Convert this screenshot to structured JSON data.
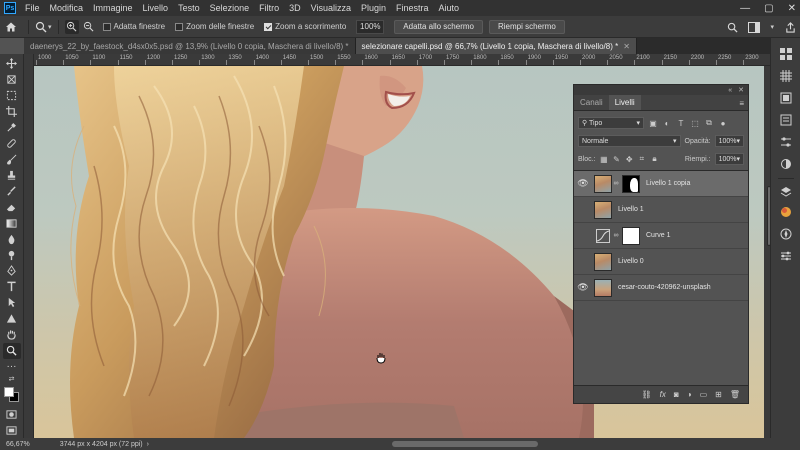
{
  "app": {
    "logo": "Ps",
    "menu": [
      "File",
      "Modifica",
      "Immagine",
      "Livello",
      "Testo",
      "Selezione",
      "Filtro",
      "3D",
      "Visualizza",
      "Plugin",
      "Finestra",
      "Aiuto"
    ],
    "window_controls": [
      "—",
      "▢",
      "✕"
    ]
  },
  "options_bar": {
    "adatta_finestre": "Adatta finestre",
    "adatta_finestre_checked": false,
    "zoom_finestre": "Zoom delle finestre",
    "zoom_finestre_checked": false,
    "zoom_scorrimento": "Zoom a scorrimento",
    "zoom_scorrimento_checked": true,
    "zoom_value": "100%",
    "adatta_schermo": "Adatta allo schermo",
    "riempi_schermo": "Riempi schermo"
  },
  "tabs": [
    {
      "label": "daenerys_22_by_faestock_d4sx0x5.psd @ 13,9% (Livello 0 copia, Maschera di livello/8) *",
      "active": false
    },
    {
      "label": "selezionare capelli.psd @ 66,7% (Livello 1 copia, Maschera di livello/8) *",
      "active": true
    }
  ],
  "ruler": {
    "labels": [
      "1000",
      "1050",
      "1100",
      "1150",
      "1200",
      "1250",
      "1300",
      "1350",
      "1400",
      "1450",
      "1500",
      "1550",
      "1600",
      "1650",
      "1700",
      "1750",
      "1800",
      "1850",
      "1900",
      "1950",
      "2000",
      "2050",
      "2100",
      "2150",
      "2200",
      "2250",
      "2300"
    ]
  },
  "status": {
    "zoom": "66,67%",
    "doc_info": "3744 px x 4204 px (72 ppi)"
  },
  "layers_panel": {
    "tab_channels": "Canali",
    "tab_layers": "Livelli",
    "filter_kind": "Tipo",
    "blend_mode": "Normale",
    "opacity_label": "Opacità:",
    "opacity_value": "100%",
    "lock_label": "Bloc.:",
    "fill_label": "Riempi.:",
    "fill_value": "100%",
    "layers": [
      {
        "name": "Livello 1 copia",
        "visible": true,
        "selected": true,
        "type": "photo-mask"
      },
      {
        "name": "Livello 1",
        "visible": false,
        "selected": false,
        "type": "photo"
      },
      {
        "name": "Curve 1",
        "visible": false,
        "selected": false,
        "type": "curves"
      },
      {
        "name": "Livello 0",
        "visible": false,
        "selected": false,
        "type": "photo"
      },
      {
        "name": "cesar-couto-420962-unsplash",
        "visible": true,
        "selected": false,
        "type": "photo"
      }
    ],
    "footer_icons": [
      "link-icon",
      "fx-icon",
      "mask-icon",
      "adjustment-icon",
      "folder-icon",
      "new-layer-icon",
      "trash-icon"
    ]
  },
  "colors": {
    "foreground": "#ffffff",
    "background": "#000000",
    "accent": "#31a8ff"
  }
}
